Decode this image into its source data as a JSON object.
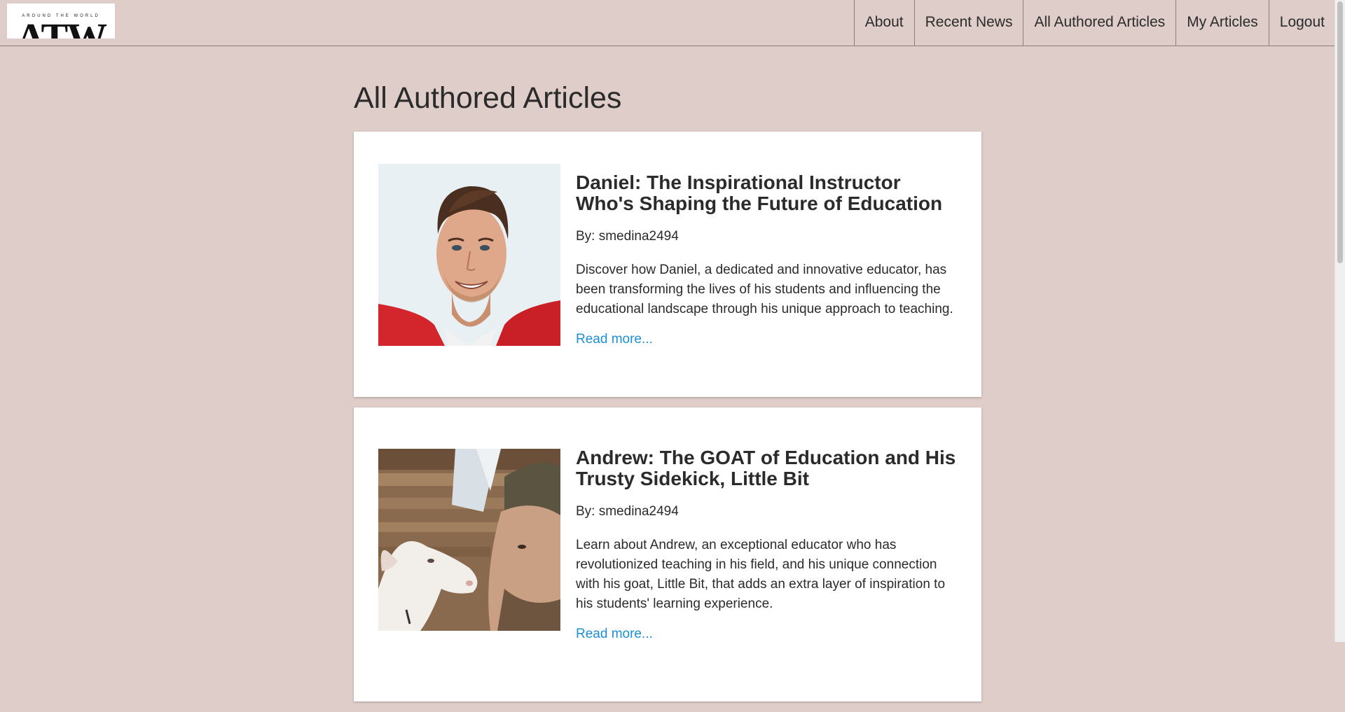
{
  "logo": {
    "tagline": "AROUND THE WORLD",
    "letters": "ATW"
  },
  "nav": {
    "items": [
      {
        "label": "About"
      },
      {
        "label": "Recent News"
      },
      {
        "label": "All Authored Articles"
      },
      {
        "label": "My Articles"
      },
      {
        "label": "Logout"
      }
    ]
  },
  "page": {
    "title": "All Authored Articles"
  },
  "articles": [
    {
      "title": "Daniel: The Inspirational Instructor Who's Shaping the Future of Education",
      "author": "By: smedina2494",
      "summary": "Discover how Daniel, a dedicated and innovative educator, has been transforming the lives of his students and influencing the educational landscape through his unique approach to teaching.",
      "read_more": "Read more..."
    },
    {
      "title": "Andrew: The GOAT of Education and His Trusty Sidekick, Little Bit",
      "author": "By: smedina2494",
      "summary": "Learn about Andrew, an exceptional educator who has revolutionized teaching in his field, and his unique connection with his goat, Little Bit, that adds an extra layer of inspiration to his students' learning experience.",
      "read_more": "Read more..."
    }
  ],
  "colors": {
    "background": "#dfcdca",
    "link": "#1d8fd2",
    "card": "#ffffff",
    "text": "#2b2b2b"
  }
}
